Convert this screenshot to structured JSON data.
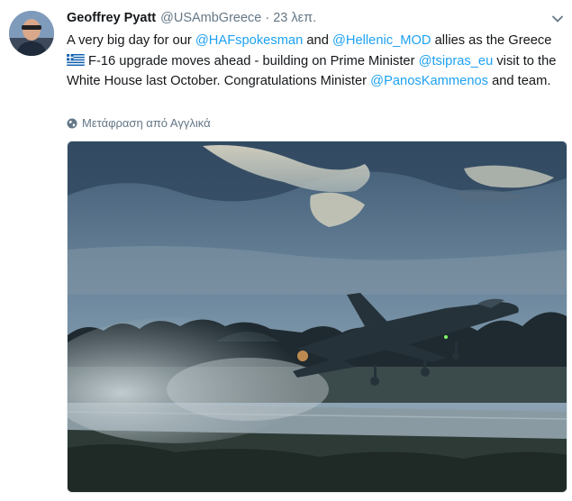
{
  "tweet": {
    "author_name": "Geoffrey Pyatt",
    "author_handle": "@USAmbGreece",
    "separator": "·",
    "timestamp": "23 λεπ.",
    "text": {
      "t1": "A very big day for our ",
      "m1": "@HAFspokesman",
      "t2": " and ",
      "m2": "@Hellenic_MOD",
      "t3": " allies as the Greece ",
      "t4": "F-16 upgrade moves ahead - building on Prime Minister ",
      "m3": "@tsipras_eu",
      "t5": " visit to the White House last October. Congratulations Minister ",
      "m4": "@PanosKammenos",
      "t6": " and team."
    },
    "translate_label": "Μετάφραση από Αγγλικά"
  },
  "icons": {
    "caret": "chevron-down-icon",
    "flag": "greece-flag-icon",
    "globe": "globe-icon"
  },
  "colors": {
    "link": "#1da1f2",
    "secondary_text": "#657786",
    "primary_text": "#14171a"
  }
}
